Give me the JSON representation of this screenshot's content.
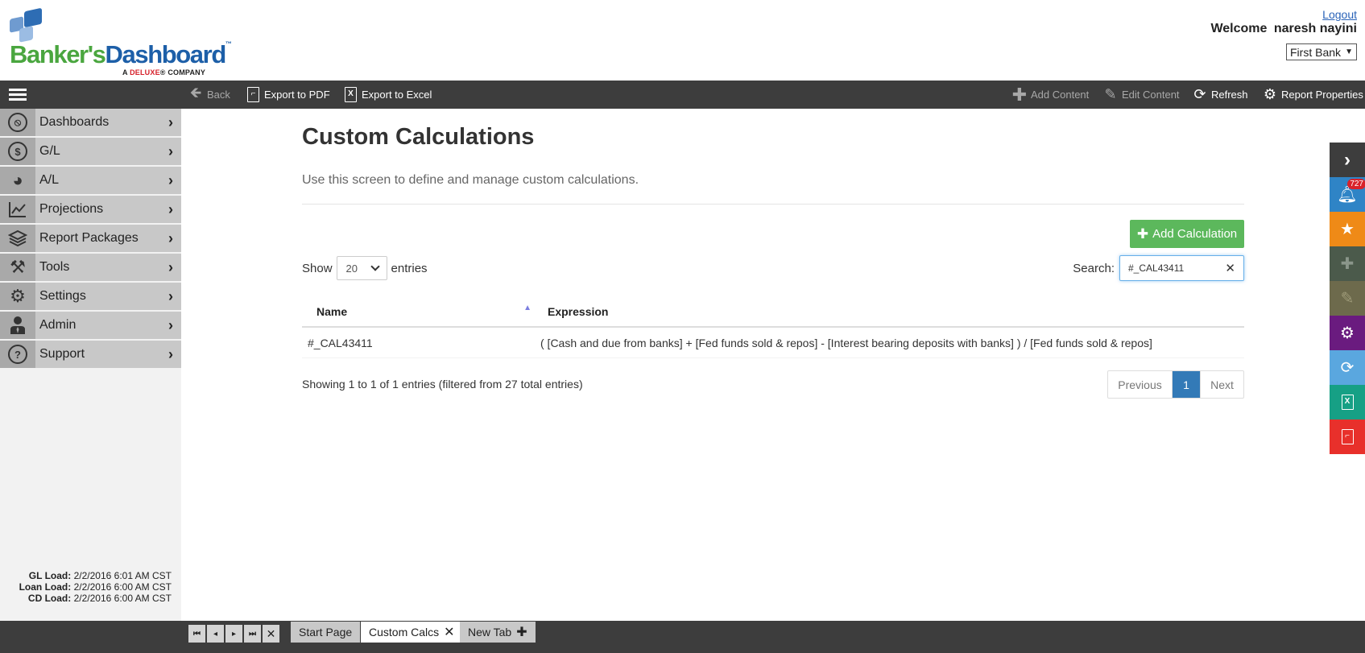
{
  "header": {
    "logo": {
      "part1": "Banker's",
      "part2": "Dashboard",
      "tm": "™",
      "sub_prefix": "A ",
      "sub_brand": "DELUXE",
      "sub_suffix": "® COMPANY"
    },
    "logout": "Logout",
    "welcome_label": "Welcome",
    "user_name": "naresh nayini",
    "bank_selected": "First Bank"
  },
  "toolbar": {
    "back": "Back",
    "export_pdf": "Export to PDF",
    "export_excel": "Export to Excel",
    "add_content": "Add Content",
    "edit_content": "Edit Content",
    "refresh": "Refresh",
    "report_properties": "Report Properties"
  },
  "sidebar": {
    "items": [
      {
        "label": "Dashboards",
        "icon": "compass-icon"
      },
      {
        "label": "G/L",
        "icon": "dollar-icon"
      },
      {
        "label": "A/L",
        "icon": "pie-chart-icon"
      },
      {
        "label": "Projections",
        "icon": "line-chart-icon"
      },
      {
        "label": "Report Packages",
        "icon": "layers-icon"
      },
      {
        "label": "Tools",
        "icon": "hammer-icon"
      },
      {
        "label": "Settings",
        "icon": "gear-icon"
      },
      {
        "label": "Admin",
        "icon": "user-suit-icon"
      },
      {
        "label": "Support",
        "icon": "question-icon"
      }
    ],
    "loads": [
      {
        "label": "GL Load:",
        "value": "2/2/2016 6:01 AM CST"
      },
      {
        "label": "Loan Load:",
        "value": "2/2/2016 6:00 AM CST"
      },
      {
        "label": "CD Load:",
        "value": "2/2/2016 6:00 AM CST"
      }
    ]
  },
  "main": {
    "title": "Custom Calculations",
    "description": "Use this screen to define and manage custom calculations.",
    "add_button": "Add Calculation",
    "show_label": "Show",
    "show_value": "20",
    "entries_label": "entries",
    "search_label": "Search:",
    "search_value": "#_CAL43411",
    "columns": [
      "Name",
      "Expression"
    ],
    "rows": [
      {
        "name": "#_CAL43411",
        "expression": "( [Cash and due from banks] + [Fed funds sold & repos] - [Interest bearing deposits with banks] ) / [Fed funds sold & repos]"
      }
    ],
    "info": "Showing 1 to 1 of 1 entries (filtered from 27 total entries)",
    "pager": {
      "previous": "Previous",
      "page": "1",
      "next": "Next"
    }
  },
  "rail": {
    "notification_count": "727",
    "colors": [
      "#3d3d3d",
      "#2f84c6",
      "#ef8a17",
      "#4b5a4b",
      "#6d6a4c",
      "#6a1b7f",
      "#5aa7df",
      "#16a085",
      "#e8302b"
    ]
  },
  "bottom": {
    "tabs": [
      {
        "label": "Start Page"
      },
      {
        "label": "Custom Calcs"
      },
      {
        "label": "New Tab"
      }
    ]
  }
}
